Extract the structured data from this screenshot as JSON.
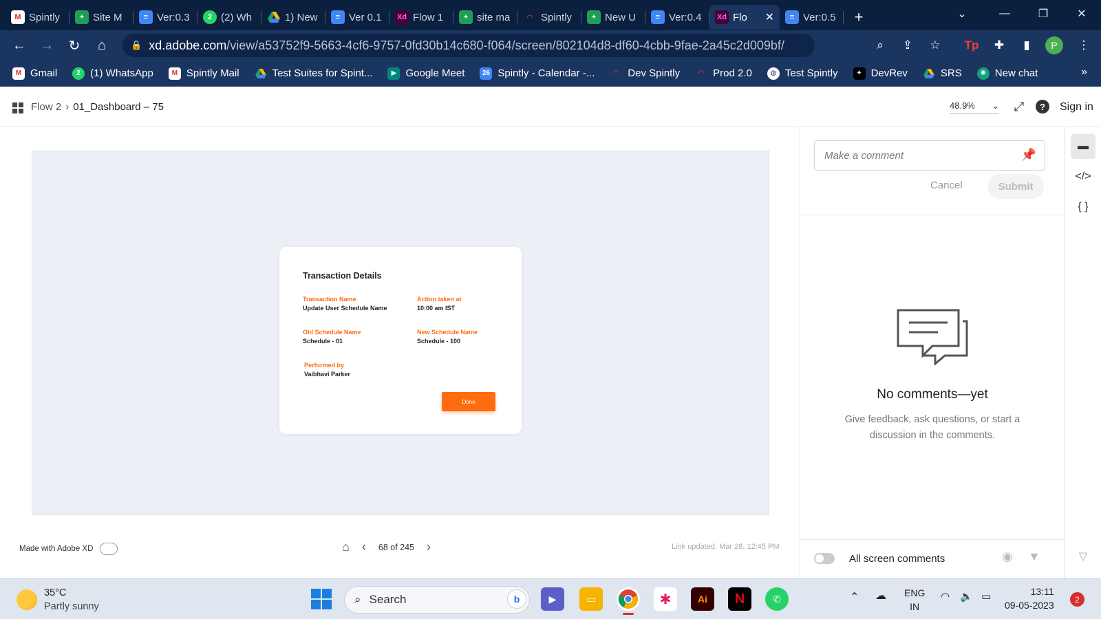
{
  "browser": {
    "tabs": [
      {
        "label": "Spintly",
        "icon": "gmail-icon"
      },
      {
        "label": "Site M",
        "icon": "sheets-icon"
      },
      {
        "label": "Ver:0.3",
        "icon": "docs-icon"
      },
      {
        "label": "(2) Wh",
        "icon": "whatsapp-icon"
      },
      {
        "label": "1) New",
        "icon": "drive-icon"
      },
      {
        "label": "Ver 0.1",
        "icon": "docs-icon"
      },
      {
        "label": "Flow 1",
        "icon": "xd-icon"
      },
      {
        "label": "site ma",
        "icon": "sheets-icon"
      },
      {
        "label": "Spintly",
        "icon": "wifi-icon"
      },
      {
        "label": "New U",
        "icon": "sheets-icon"
      },
      {
        "label": "Ver:0.4",
        "icon": "docs-icon"
      },
      {
        "label": "Flo",
        "icon": "xd-icon",
        "active": true
      },
      {
        "label": "Ver:0.5",
        "icon": "docs-icon"
      }
    ],
    "url_host": "xd.adobe.com",
    "url_path": "/view/a53752f9-5663-4cf6-9757-0fd30b14c680-f064/screen/802104d8-df60-4cbb-9fae-2a45c2d009bf/",
    "profile_initial": "P",
    "bookmarks": [
      {
        "label": "Gmail"
      },
      {
        "label": "(1) WhatsApp"
      },
      {
        "label": "Spintly Mail"
      },
      {
        "label": "Test Suites for Spint..."
      },
      {
        "label": "Google Meet"
      },
      {
        "label": "Spintly - Calendar -..."
      },
      {
        "label": "Dev Spintly"
      },
      {
        "label": "Prod 2.0"
      },
      {
        "label": "Test Spintly"
      },
      {
        "label": "DevRev"
      },
      {
        "label": "SRS"
      },
      {
        "label": "New chat"
      }
    ]
  },
  "xd": {
    "breadcrumb_root": "Flow 2",
    "breadcrumb_current": "01_Dashboard – 75",
    "zoom": "48.9%",
    "sign_in": "Sign in",
    "card": {
      "title": "Transaction Details",
      "fields": {
        "txn_name_label": "Transaction Name",
        "txn_name_value": "Update User Schedule Name",
        "action_label": "Action taken at",
        "action_value": "10:00 am IST",
        "old_label": "Old Schedule Name",
        "old_value": "Schedule - 01",
        "new_label": "New Schedule Name",
        "new_value": "Schedule - 100",
        "performed_label": "Performed by",
        "performed_value": "Vaibhavi Parker"
      },
      "done": "Done"
    },
    "made_with": "Made with Adobe XD",
    "pager": "68 of 245",
    "link_updated": "Link updated: Mar 28, 12:45 PM",
    "comments": {
      "placeholder": "Make a comment",
      "cancel": "Cancel",
      "submit": "Submit",
      "empty_title": "No comments—yet",
      "empty_sub": "Give feedback, ask questions, or start a discussion in the comments.",
      "all_screen": "All screen comments"
    }
  },
  "taskbar": {
    "temp": "35°C",
    "condition": "Partly sunny",
    "search": "Search",
    "lang": "ENG",
    "region": "IN",
    "time": "13:11",
    "date": "09-05-2023",
    "notifications": "2"
  },
  "colors": {
    "accent_orange": "#ff6b0f",
    "browser_bg": "#1b3561"
  }
}
